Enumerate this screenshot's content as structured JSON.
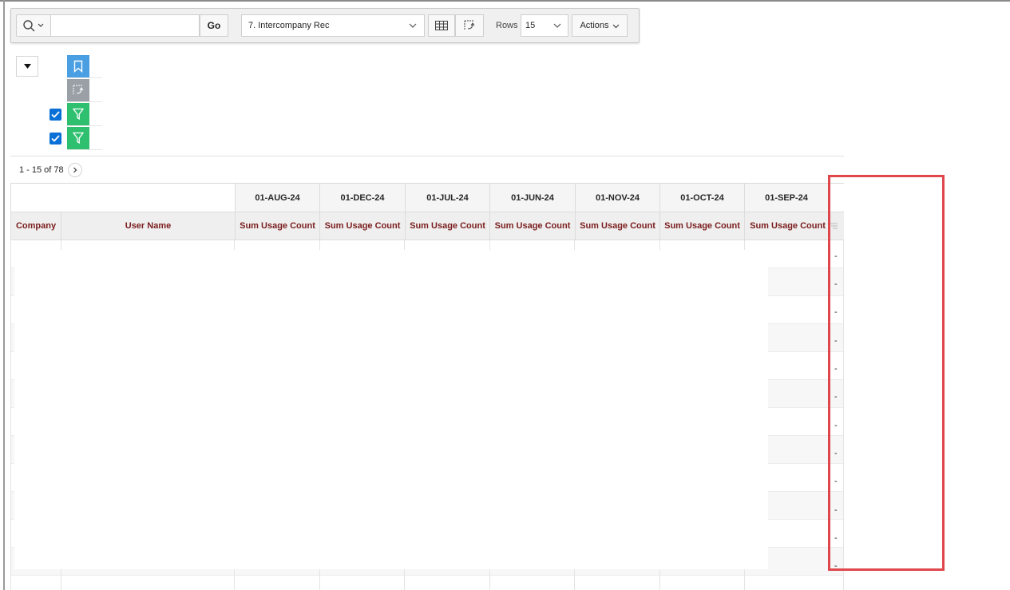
{
  "toolbar": {
    "go_label": "Go",
    "search_placeholder": "",
    "report_name": "7. Intercompany Rec",
    "rows_label": "Rows",
    "rows_value": "15",
    "actions_label": "Actions"
  },
  "settings": {
    "filters_checked": [
      true,
      true
    ]
  },
  "pagination": {
    "range_text": "1 - 15 of 78"
  },
  "table": {
    "pivot_headers": [
      "01-AUG-24",
      "01-DEC-24",
      "01-JUL-24",
      "01-JUN-24",
      "01-NOV-24",
      "01-OCT-24",
      "01-SEP-24"
    ],
    "columns": {
      "company": "Company",
      "user_name": "User Name",
      "measure": "Sum Usage Count"
    },
    "last_column_values": [
      "-",
      "-",
      "-",
      "-",
      "-",
      "-",
      "-",
      "-",
      "-",
      "-",
      "-",
      "-"
    ]
  },
  "colors": {
    "accent_blue": "#4a9fe3",
    "filter_green": "#2ebf6f",
    "highlight_red": "#e0474c",
    "header_text": "#7a1c1c"
  }
}
